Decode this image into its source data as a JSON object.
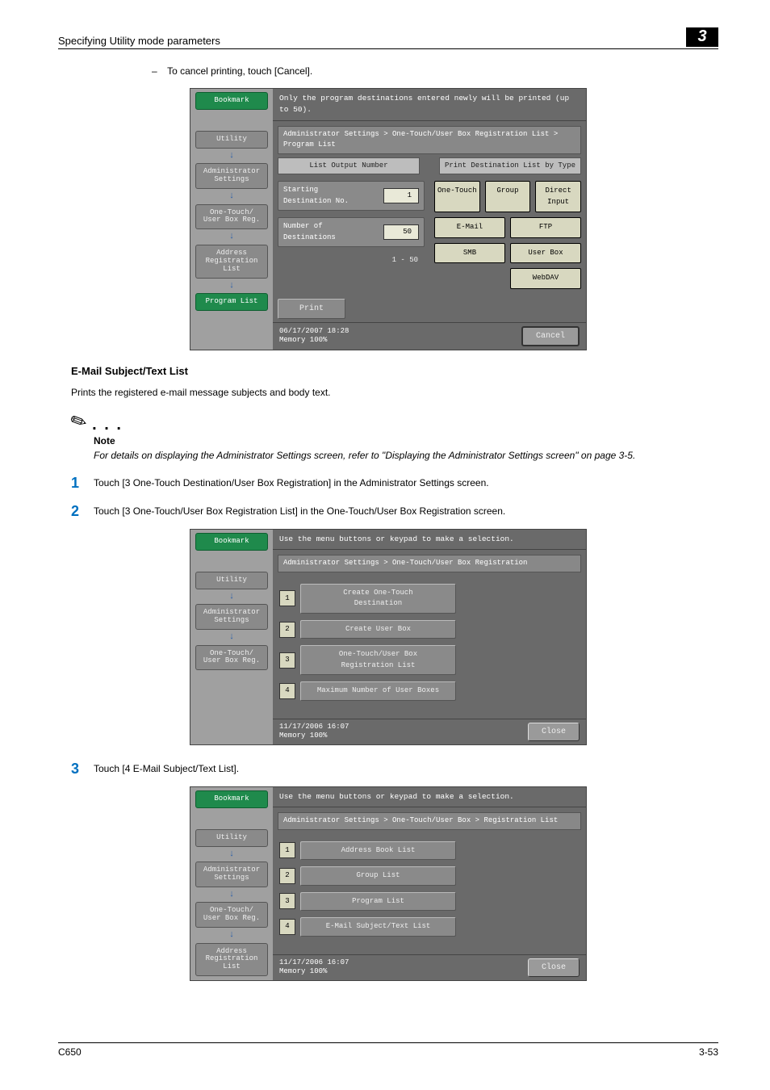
{
  "header": {
    "title": "Specifying Utility mode parameters",
    "chapter": "3"
  },
  "bullet": {
    "dash": "–",
    "text": "To cancel printing, touch [Cancel]."
  },
  "section_title": "E-Mail Subject/Text List",
  "intro": "Prints the registered e-mail message subjects and body text.",
  "note": {
    "label": "Note",
    "body": "For details on displaying the Administrator Settings screen, refer to \"Displaying the Administrator Settings screen\" on page 3-5."
  },
  "steps": {
    "s1": {
      "num": "1",
      "text": "Touch [3 One-Touch Destination/User Box Registration] in the Administrator Settings screen."
    },
    "s2": {
      "num": "2",
      "text": "Touch [3 One-Touch/User Box Registration List] in the One-Touch/User Box Registration screen."
    },
    "s3": {
      "num": "3",
      "text": "Touch [4 E-Mail Subject/Text List]."
    }
  },
  "panel1": {
    "top": "Only the program destinations entered newly will be printed (up to 50).",
    "side": {
      "bookmark": "Bookmark",
      "utility": "Utility",
      "admin": "Administrator\nSettings",
      "onetouch": "One-Touch/\nUser Box Reg.",
      "addr": "Address\nRegistration\nList",
      "program": "Program List"
    },
    "crumb": "Administrator Settings > One-Touch/User Box Registration List > Program List",
    "tabs": {
      "left": "List Output Number",
      "right": "Print Destination List by Type"
    },
    "left_col": {
      "start_label": "Starting\nDestination No.",
      "start_val": "1",
      "num_label": "Number of\nDestinations",
      "num_val": "50",
      "range": "1  -  50"
    },
    "right_col": {
      "onetouch": "One-Touch",
      "group": "Group",
      "direct": "Direct\nInput",
      "email": "E-Mail",
      "ftp": "FTP",
      "smb": "SMB",
      "userbox": "User Box",
      "webdav": "WebDAV"
    },
    "print": "Print",
    "status": {
      "dt": "06/17/2007   18:28",
      "mem": "Memory       100%",
      "cancel": "Cancel"
    }
  },
  "panel2": {
    "top": "Use the menu buttons or keypad to make a selection.",
    "crumb": "Administrator Settings > One-Touch/User Box Registration",
    "side": {
      "bookmark": "Bookmark",
      "utility": "Utility",
      "admin": "Administrator\nSettings",
      "onetouch": "One-Touch/\nUser Box Reg."
    },
    "items": {
      "i1": "Create One-Touch\nDestination",
      "i2": "Create User Box",
      "i3": "One-Touch/User Box\nRegistration List",
      "i4": "Maximum Number of User Boxes"
    },
    "status": {
      "dt": "11/17/2006   16:07",
      "mem": "Memory       100%",
      "close": "Close"
    }
  },
  "panel3": {
    "top": "Use the menu buttons or keypad to make a selection.",
    "crumb": "Administrator Settings > One-Touch/User Box > Registration List",
    "side": {
      "bookmark": "Bookmark",
      "utility": "Utility",
      "admin": "Administrator\nSettings",
      "onetouch": "One-Touch/\nUser Box Reg.",
      "addr": "Address\nRegistration\nList"
    },
    "items": {
      "i1": "Address Book List",
      "i2": "Group List",
      "i3": "Program List",
      "i4": "E-Mail Subject/Text List"
    },
    "status": {
      "dt": "11/17/2006   16:07",
      "mem": "Memory       100%",
      "close": "Close"
    }
  },
  "footer": {
    "left": "C650",
    "right": "3-53"
  }
}
